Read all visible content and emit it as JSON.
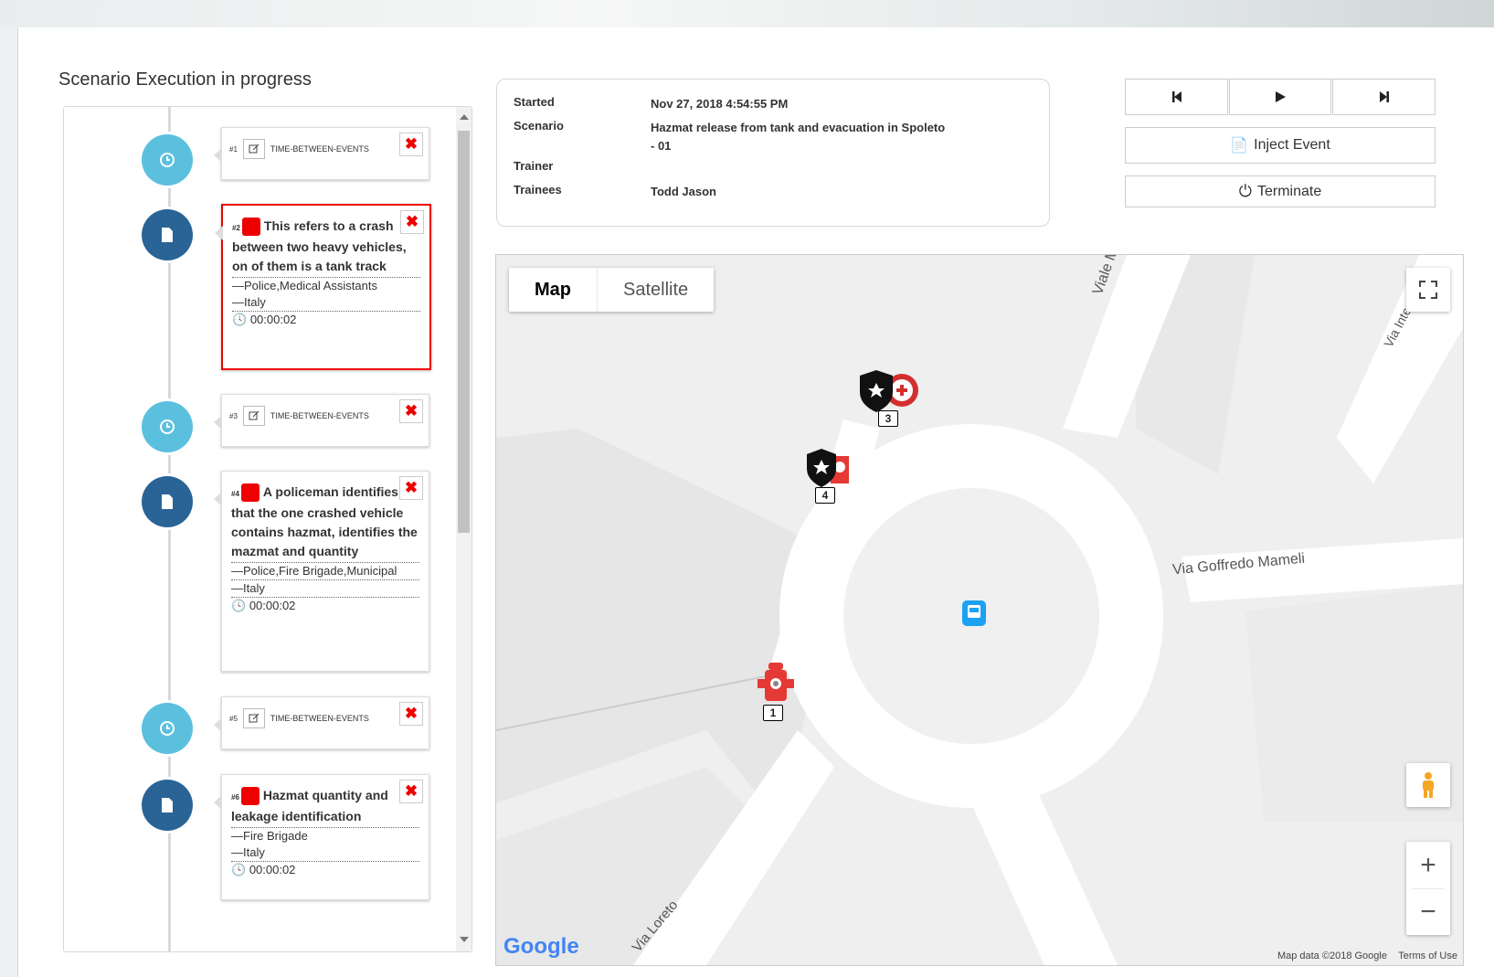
{
  "page": {
    "title": "Scenario Execution in progress"
  },
  "timeline": [
    {
      "type": "timer",
      "num": "#1",
      "label": "TIME-BETWEEN-EVENTS"
    },
    {
      "type": "event",
      "num": "#2",
      "text": "This refers to a crash between two heavy vehicles, on of them is a tank track",
      "agencies": "—Police,Medical Assistants",
      "country": "—Italy",
      "time": "00:00:02",
      "selected": true
    },
    {
      "type": "timer",
      "num": "#3",
      "label": "TIME-BETWEEN-EVENTS"
    },
    {
      "type": "event",
      "num": "#4",
      "text": "A policeman identifies that the one crashed vehicle contains hazmat, identifies the mazmat and quantity",
      "agencies": "—Police,Fire Brigade,Municipal",
      "country": "—Italy",
      "time": "00:00:02"
    },
    {
      "type": "timer",
      "num": "#5",
      "label": "TIME-BETWEEN-EVENTS"
    },
    {
      "type": "event",
      "num": "#6",
      "text": "Hazmat quantity and leakage identification",
      "agencies": "—Fire Brigade",
      "country": "—Italy",
      "time": "00:00:02"
    }
  ],
  "info": {
    "started_label": "Started",
    "started": "Nov 27, 2018 4:54:55 PM",
    "scenario_label": "Scenario",
    "scenario": "Hazmat release from tank and evacuation in Spoleto - 01",
    "trainer_label": "Trainer",
    "trainer": "",
    "trainees_label": "Trainees",
    "trainees": "Todd Jason"
  },
  "controls": {
    "inject": "Inject Event",
    "terminate": "Terminate"
  },
  "map": {
    "type_map": "Map",
    "type_satellite": "Satellite",
    "streets": [
      "Viale Martir",
      "Via Interr",
      "Via Goffredo Mameli",
      "Via Loreto"
    ],
    "markers": [
      "3",
      "4",
      "1"
    ],
    "google": "Google",
    "attribution": "Map data ©2018 Google",
    "terms": "Terms of Use"
  },
  "colors": {
    "timer": "#5bc0de",
    "doc": "#2a6496",
    "alert": "#e00000"
  }
}
